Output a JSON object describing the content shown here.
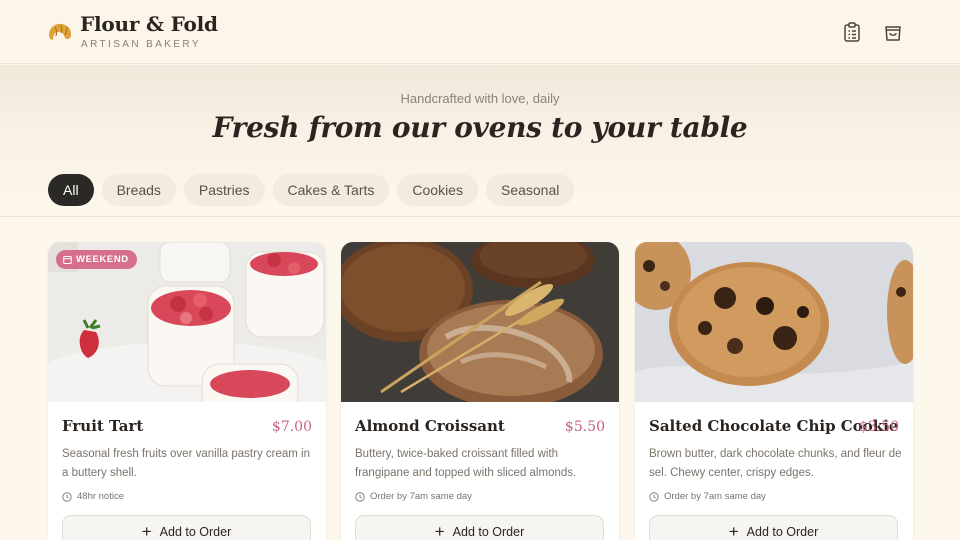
{
  "brand": {
    "name": "Flour & Fold",
    "subtitle": "ARTISAN BAKERY",
    "logo_icon": "croissant-icon"
  },
  "header": {
    "icons": [
      "order-list-icon",
      "shopping-bag-icon"
    ]
  },
  "hero": {
    "tagline": "Handcrafted with love, daily",
    "headline": "Fresh from our ovens to your table"
  },
  "categories": [
    {
      "label": "All",
      "active": true
    },
    {
      "label": "Breads",
      "active": false
    },
    {
      "label": "Pastries",
      "active": false
    },
    {
      "label": "Cakes & Tarts",
      "active": false
    },
    {
      "label": "Cookies",
      "active": false
    },
    {
      "label": "Seasonal",
      "active": false
    }
  ],
  "products": [
    {
      "title": "Fruit Tart",
      "price": "$7.00",
      "description": "Seasonal fresh fruits over vanilla pastry cream in a buttery shell.",
      "note": "48hr notice",
      "badge": "WEEKEND",
      "button": "Add to Order"
    },
    {
      "title": "Almond Croissant",
      "price": "$5.50",
      "description": "Buttery, twice-baked croissant filled with frangipane and topped with sliced almonds.",
      "note": "Order by 7am same day",
      "button": "Add to Order"
    },
    {
      "title": "Salted Chocolate Chip Cookie",
      "price": "$3.50",
      "description": "Brown butter, dark chocolate chunks, and fleur de sel. Chewy center, crispy edges.",
      "note": "Order by 7am same day",
      "button": "Add to Order"
    }
  ],
  "colors": {
    "accent": "#c9627f",
    "badge": "#d66f8c",
    "dark": "#2b2926",
    "background": "#fdf7ec"
  }
}
